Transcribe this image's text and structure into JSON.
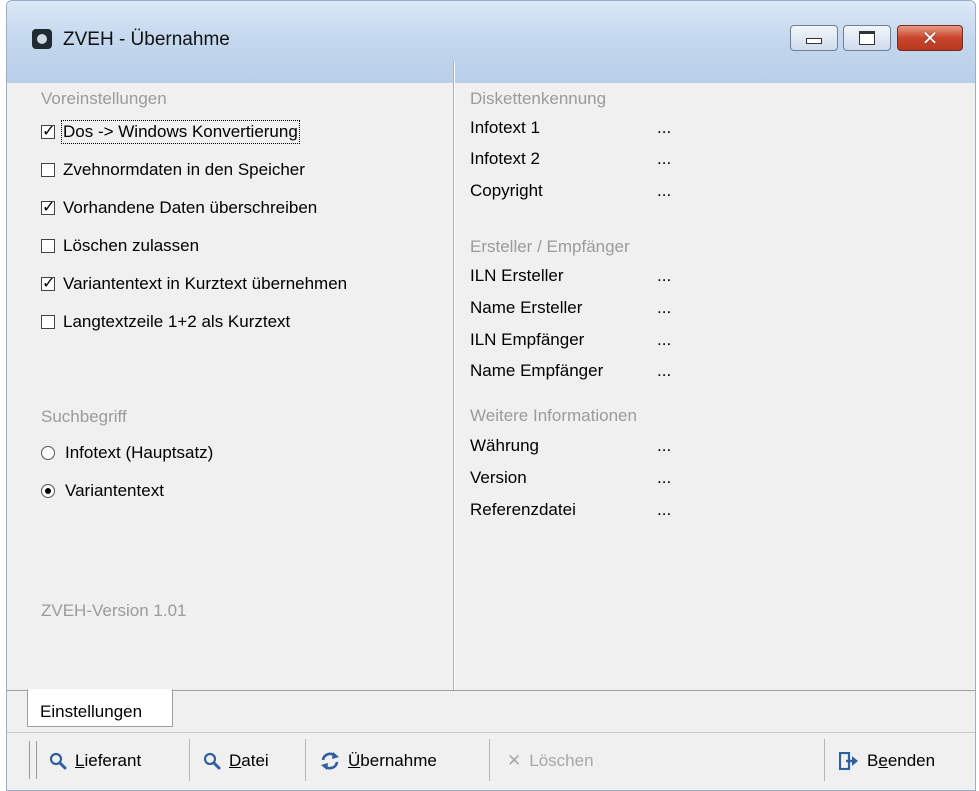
{
  "window": {
    "title": "ZVEH - Übernahme"
  },
  "left": {
    "presets_title": "Voreinstellungen",
    "checkboxes": [
      {
        "label": "Dos -> Windows Konvertierung",
        "checked": true
      },
      {
        "label": "Zvehnormdaten in den Speicher",
        "checked": false
      },
      {
        "label": "Vorhandene Daten überschreiben",
        "checked": true
      },
      {
        "label": "Löschen zulassen",
        "checked": false
      },
      {
        "label": "Variantentext in Kurztext übernehmen",
        "checked": true
      },
      {
        "label": "Langtextzeile 1+2 als Kurztext",
        "checked": false
      }
    ],
    "search_title": "Suchbegriff",
    "radios": [
      {
        "label": "Infotext (Hauptsatz)",
        "selected": false
      },
      {
        "label": "Variantentext",
        "selected": true
      }
    ],
    "version": "ZVEH-Version 1.01"
  },
  "right": {
    "disk_title": "Diskettenkennung",
    "disk": [
      {
        "label": "Infotext 1",
        "value": "..."
      },
      {
        "label": "Infotext 2",
        "value": "..."
      },
      {
        "label": "Copyright",
        "value": "..."
      }
    ],
    "creator_title": "Ersteller / Empfänger",
    "creator": [
      {
        "label": "ILN Ersteller",
        "value": "..."
      },
      {
        "label": "Name Ersteller",
        "value": "..."
      },
      {
        "label": "ILN Empfänger",
        "value": "..."
      },
      {
        "label": "Name Empfänger",
        "value": "..."
      }
    ],
    "more_title": "Weitere Informationen",
    "more": [
      {
        "label": "Währung",
        "value": "..."
      },
      {
        "label": "Version",
        "value": "..."
      },
      {
        "label": "Referenzdatei",
        "value": "..."
      }
    ]
  },
  "tabs": [
    {
      "label": "Einstellungen"
    }
  ],
  "toolbar": {
    "lieferant": {
      "accel": "L",
      "rest": "ieferant"
    },
    "datei": {
      "accel": "D",
      "rest": "atei"
    },
    "uebernahme": {
      "accel": "Ü",
      "rest": "bernahme"
    },
    "loeschen": "Löschen",
    "beenden": {
      "pre": "B",
      "accel": "e",
      "rest": "enden"
    }
  },
  "icons": [
    "app-icon",
    "search-icon",
    "refresh-icon",
    "delete-icon",
    "exit-icon"
  ],
  "colors": {
    "group_title": "#9b9b9b",
    "disabled": "#a8a8a8",
    "close_button": "#c7452a"
  }
}
